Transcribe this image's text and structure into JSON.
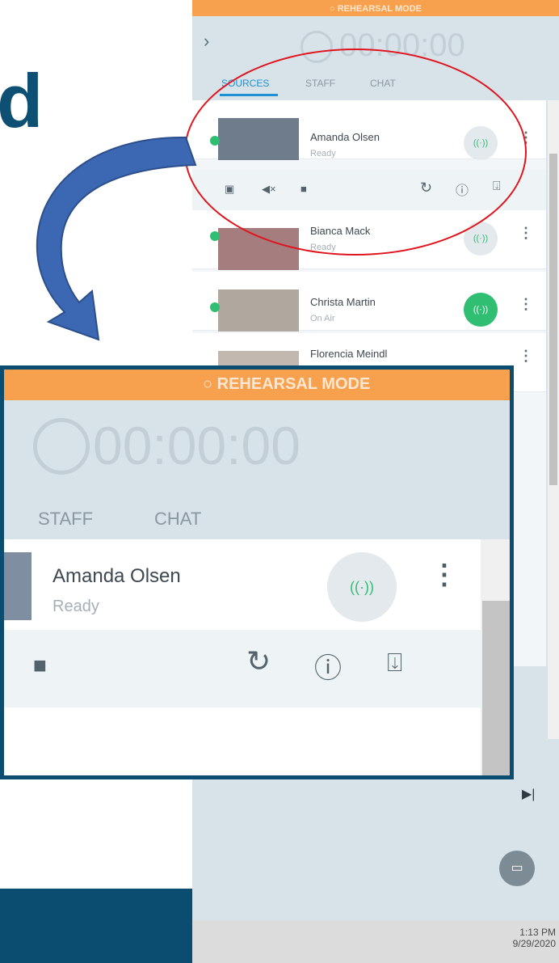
{
  "slide": {
    "heading_fragment": "d"
  },
  "panel": {
    "mode_banner": "REHEARSAL MODE",
    "timer": "00:00:00",
    "tabs": [
      "SOURCES",
      "STAFF",
      "CHAT"
    ],
    "sources": [
      {
        "name": "Amanda Olsen",
        "status": "Ready"
      },
      {
        "name": "Bianca Mack",
        "status": "Ready"
      },
      {
        "name": "Christa Martin",
        "status": "On Air"
      },
      {
        "name": "Florencia Meindl",
        "status": ""
      }
    ]
  },
  "inset": {
    "mode_banner": "REHEARSAL MODE",
    "timer": "00:00:00",
    "tabs": [
      "STAFF",
      "CHAT"
    ],
    "source": {
      "name": "Amanda Olsen",
      "status": "Ready"
    }
  },
  "clock": {
    "time": "1:13 PM",
    "date": "9/29/2020"
  },
  "colors": {
    "accent": "#1f8fd6",
    "banner": "#f7a14e",
    "live": "#2fbe72",
    "frame": "#0b4d70",
    "annotation": "#e0141c"
  },
  "icons": [
    "chevron-right-icon",
    "broadcast-icon",
    "kebab-icon",
    "layout-icon",
    "mute-icon",
    "camera-off-icon",
    "refresh-icon",
    "info-icon",
    "presenter-icon",
    "screen-icon",
    "skip-forward-icon"
  ]
}
